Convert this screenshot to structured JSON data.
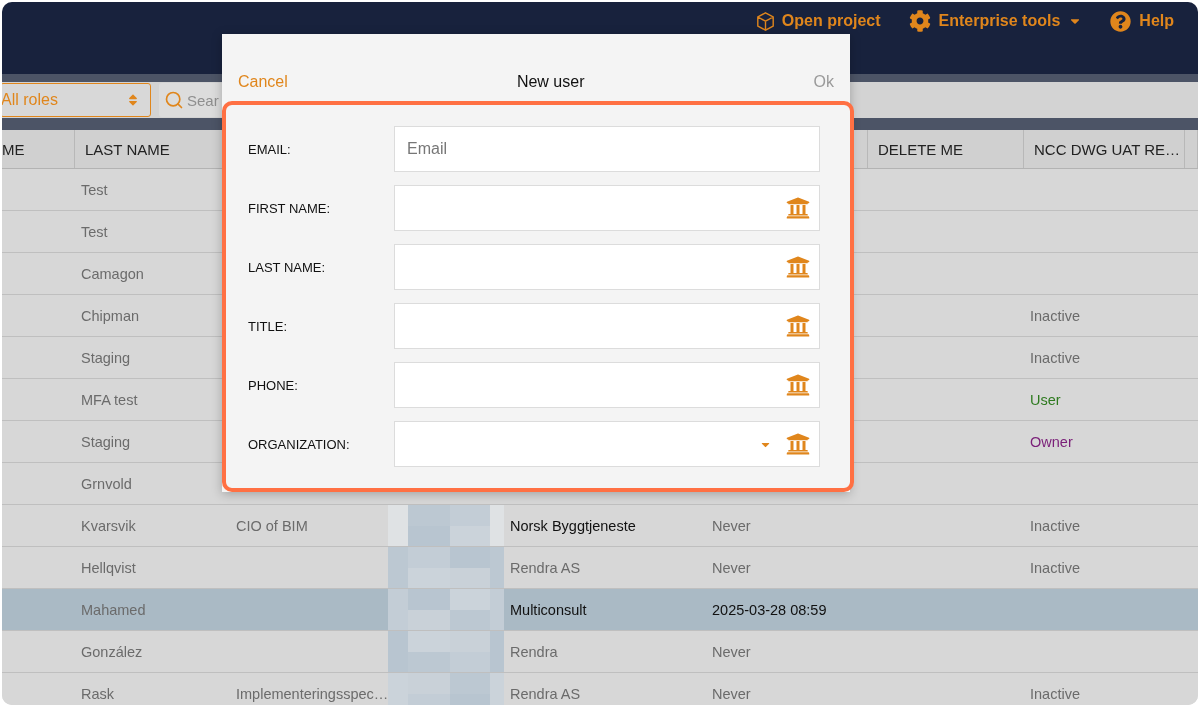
{
  "header": {
    "nav": [
      {
        "kind": "project",
        "label": "Open project"
      },
      {
        "kind": "tools",
        "label": "Enterprise tools"
      },
      {
        "kind": "help",
        "label": "Help"
      }
    ]
  },
  "toolbar": {
    "role_filter": "All roles",
    "search": {
      "placeholder": "Sear"
    }
  },
  "table": {
    "headers": {
      "first": "ME",
      "last_name": "LAST NAME",
      "delete_me": "DELETE ME",
      "ncc": "NCC DWG UAT RE…"
    },
    "rows": [
      {
        "selected": false,
        "last_name": "Test"
      },
      {
        "selected": false,
        "last_name": "Test"
      },
      {
        "selected": false,
        "last_name": "Camagon"
      },
      {
        "selected": false,
        "last_name": "Chipman",
        "ncc": {
          "text": "Inactive",
          "color": "#6b6b6b"
        }
      },
      {
        "selected": false,
        "last_name": "Staging",
        "ncc": {
          "text": "Inactive",
          "color": "#6b6b6b"
        }
      },
      {
        "selected": false,
        "last_name": "MFA test",
        "ncc": {
          "text": "User",
          "color": "#2e7a1f"
        }
      },
      {
        "selected": false,
        "last_name": "Staging",
        "ncc": {
          "text": "Owner",
          "color": "#7a1f78"
        }
      },
      {
        "selected": false,
        "last_name": "Grnvold"
      },
      {
        "selected": false,
        "last_name": "Kvarsvik",
        "title": "CIO of BIM",
        "organization": "Norsk Byggtjeneste",
        "org_active": true,
        "last_login": "Never",
        "ncc": {
          "text": "Inactive",
          "color": "#6b6b6b"
        }
      },
      {
        "selected": false,
        "last_name": "Hellqvist",
        "organization": "Rendra AS",
        "org_active": false,
        "last_login": "Never",
        "ncc": {
          "text": "Inactive",
          "color": "#6b6b6b"
        }
      },
      {
        "selected": true,
        "last_name": "Mahamed",
        "organization": "Multiconsult",
        "org_active": true,
        "last_login": "2025-03-28 08:59"
      },
      {
        "selected": false,
        "last_name": "González",
        "organization": "Rendra",
        "org_active": false,
        "last_login": "Never"
      },
      {
        "selected": false,
        "last_name": "Rask",
        "title": "Implementeringsspec…",
        "organization": "Rendra AS",
        "org_active": false,
        "last_login": "Never",
        "ncc": {
          "text": "Inactive",
          "color": "#6b6b6b"
        }
      }
    ]
  },
  "dialog": {
    "title": "New user",
    "cancel": "Cancel",
    "ok": {
      "label": "Ok",
      "disabled": true
    },
    "fields": [
      {
        "kind": "email",
        "label": "EMAIL:",
        "placeholder": "Email"
      },
      {
        "kind": "text",
        "label": "FIRST NAME:"
      },
      {
        "kind": "text",
        "label": "LAST NAME:"
      },
      {
        "kind": "text",
        "label": "TITLE:"
      },
      {
        "kind": "text",
        "label": "PHONE:"
      },
      {
        "kind": "select",
        "label": "ORGANIZATION:"
      }
    ]
  }
}
